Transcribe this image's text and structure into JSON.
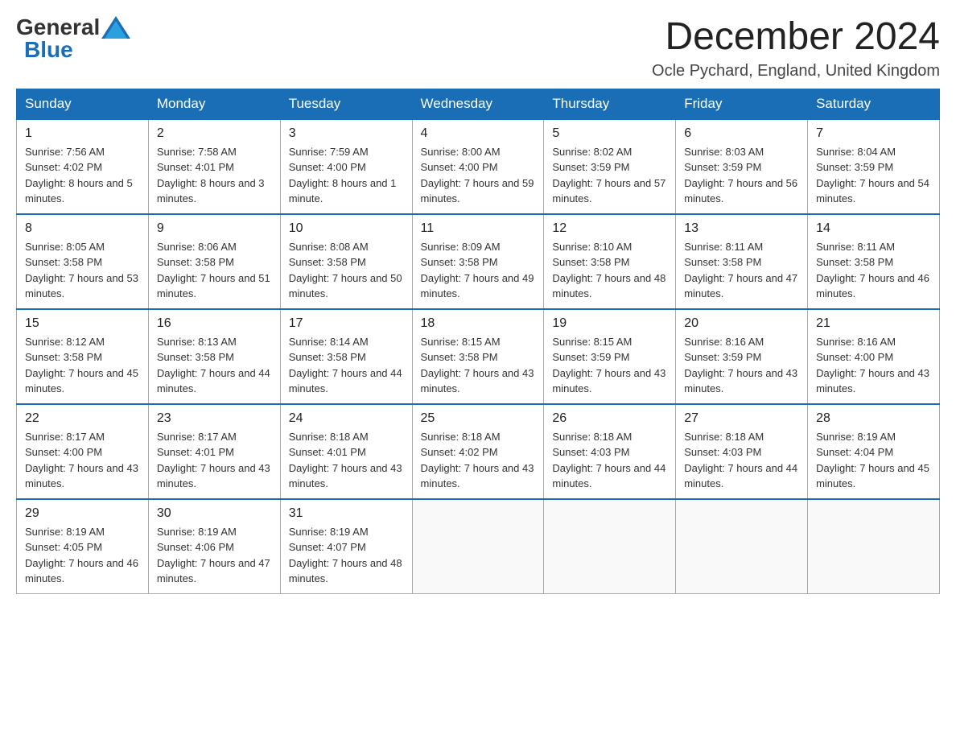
{
  "header": {
    "logo": {
      "general": "General",
      "blue": "Blue"
    },
    "title": "December 2024",
    "location": "Ocle Pychard, England, United Kingdom"
  },
  "calendar": {
    "days_of_week": [
      "Sunday",
      "Monday",
      "Tuesday",
      "Wednesday",
      "Thursday",
      "Friday",
      "Saturday"
    ],
    "weeks": [
      [
        {
          "day": 1,
          "sunrise": "7:56 AM",
          "sunset": "4:02 PM",
          "daylight": "8 hours and 5 minutes."
        },
        {
          "day": 2,
          "sunrise": "7:58 AM",
          "sunset": "4:01 PM",
          "daylight": "8 hours and 3 minutes."
        },
        {
          "day": 3,
          "sunrise": "7:59 AM",
          "sunset": "4:00 PM",
          "daylight": "8 hours and 1 minute."
        },
        {
          "day": 4,
          "sunrise": "8:00 AM",
          "sunset": "4:00 PM",
          "daylight": "7 hours and 59 minutes."
        },
        {
          "day": 5,
          "sunrise": "8:02 AM",
          "sunset": "3:59 PM",
          "daylight": "7 hours and 57 minutes."
        },
        {
          "day": 6,
          "sunrise": "8:03 AM",
          "sunset": "3:59 PM",
          "daylight": "7 hours and 56 minutes."
        },
        {
          "day": 7,
          "sunrise": "8:04 AM",
          "sunset": "3:59 PM",
          "daylight": "7 hours and 54 minutes."
        }
      ],
      [
        {
          "day": 8,
          "sunrise": "8:05 AM",
          "sunset": "3:58 PM",
          "daylight": "7 hours and 53 minutes."
        },
        {
          "day": 9,
          "sunrise": "8:06 AM",
          "sunset": "3:58 PM",
          "daylight": "7 hours and 51 minutes."
        },
        {
          "day": 10,
          "sunrise": "8:08 AM",
          "sunset": "3:58 PM",
          "daylight": "7 hours and 50 minutes."
        },
        {
          "day": 11,
          "sunrise": "8:09 AM",
          "sunset": "3:58 PM",
          "daylight": "7 hours and 49 minutes."
        },
        {
          "day": 12,
          "sunrise": "8:10 AM",
          "sunset": "3:58 PM",
          "daylight": "7 hours and 48 minutes."
        },
        {
          "day": 13,
          "sunrise": "8:11 AM",
          "sunset": "3:58 PM",
          "daylight": "7 hours and 47 minutes."
        },
        {
          "day": 14,
          "sunrise": "8:11 AM",
          "sunset": "3:58 PM",
          "daylight": "7 hours and 46 minutes."
        }
      ],
      [
        {
          "day": 15,
          "sunrise": "8:12 AM",
          "sunset": "3:58 PM",
          "daylight": "7 hours and 45 minutes."
        },
        {
          "day": 16,
          "sunrise": "8:13 AM",
          "sunset": "3:58 PM",
          "daylight": "7 hours and 44 minutes."
        },
        {
          "day": 17,
          "sunrise": "8:14 AM",
          "sunset": "3:58 PM",
          "daylight": "7 hours and 44 minutes."
        },
        {
          "day": 18,
          "sunrise": "8:15 AM",
          "sunset": "3:58 PM",
          "daylight": "7 hours and 43 minutes."
        },
        {
          "day": 19,
          "sunrise": "8:15 AM",
          "sunset": "3:59 PM",
          "daylight": "7 hours and 43 minutes."
        },
        {
          "day": 20,
          "sunrise": "8:16 AM",
          "sunset": "3:59 PM",
          "daylight": "7 hours and 43 minutes."
        },
        {
          "day": 21,
          "sunrise": "8:16 AM",
          "sunset": "4:00 PM",
          "daylight": "7 hours and 43 minutes."
        }
      ],
      [
        {
          "day": 22,
          "sunrise": "8:17 AM",
          "sunset": "4:00 PM",
          "daylight": "7 hours and 43 minutes."
        },
        {
          "day": 23,
          "sunrise": "8:17 AM",
          "sunset": "4:01 PM",
          "daylight": "7 hours and 43 minutes."
        },
        {
          "day": 24,
          "sunrise": "8:18 AM",
          "sunset": "4:01 PM",
          "daylight": "7 hours and 43 minutes."
        },
        {
          "day": 25,
          "sunrise": "8:18 AM",
          "sunset": "4:02 PM",
          "daylight": "7 hours and 43 minutes."
        },
        {
          "day": 26,
          "sunrise": "8:18 AM",
          "sunset": "4:03 PM",
          "daylight": "7 hours and 44 minutes."
        },
        {
          "day": 27,
          "sunrise": "8:18 AM",
          "sunset": "4:03 PM",
          "daylight": "7 hours and 44 minutes."
        },
        {
          "day": 28,
          "sunrise": "8:19 AM",
          "sunset": "4:04 PM",
          "daylight": "7 hours and 45 minutes."
        }
      ],
      [
        {
          "day": 29,
          "sunrise": "8:19 AM",
          "sunset": "4:05 PM",
          "daylight": "7 hours and 46 minutes."
        },
        {
          "day": 30,
          "sunrise": "8:19 AM",
          "sunset": "4:06 PM",
          "daylight": "7 hours and 47 minutes."
        },
        {
          "day": 31,
          "sunrise": "8:19 AM",
          "sunset": "4:07 PM",
          "daylight": "7 hours and 48 minutes."
        },
        null,
        null,
        null,
        null
      ]
    ]
  }
}
